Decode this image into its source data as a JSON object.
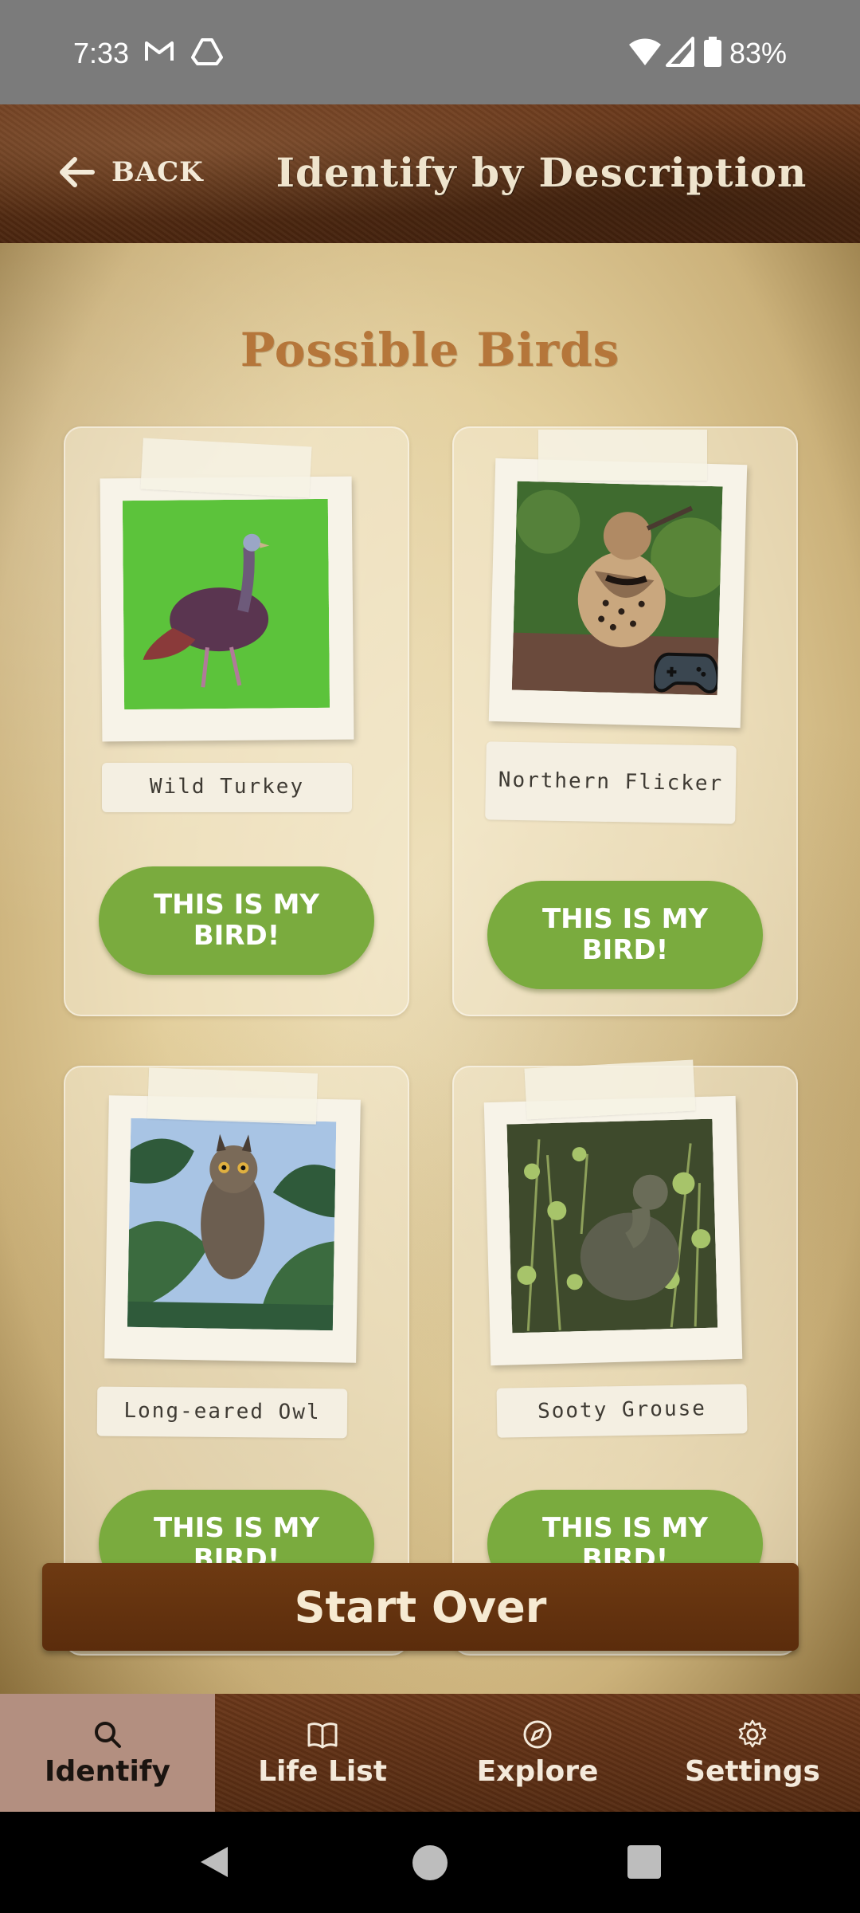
{
  "status_bar": {
    "time": "7:33",
    "battery_percent": "83%",
    "icons": [
      "gmail-icon",
      "drive-icon",
      "wifi-icon",
      "signal-icon",
      "battery-icon"
    ]
  },
  "header": {
    "back_label": "BACK",
    "title": "Identify by Description"
  },
  "main": {
    "heading": "Possible Birds",
    "select_button_label": "THIS IS MY BIRD!",
    "birds": [
      {
        "name": "Wild Turkey"
      },
      {
        "name": "Northern Flicker"
      },
      {
        "name": "Long-eared Owl"
      },
      {
        "name": "Sooty Grouse"
      }
    ],
    "start_over_label": "Start Over"
  },
  "bottom_nav": {
    "items": [
      {
        "label": "Identify",
        "icon": "search-icon",
        "active": true
      },
      {
        "label": "Life List",
        "icon": "book-icon",
        "active": false
      },
      {
        "label": "Explore",
        "icon": "compass-icon",
        "active": false
      },
      {
        "label": "Settings",
        "icon": "gear-icon",
        "active": false
      }
    ]
  },
  "colors": {
    "header_brown": "#5a2f14",
    "parchment": "#e3cf9d",
    "heading_orange": "#b5763a",
    "button_green": "#7aab3e",
    "start_over_brown": "#5b2c0c",
    "nav_active": "#b38f80"
  }
}
